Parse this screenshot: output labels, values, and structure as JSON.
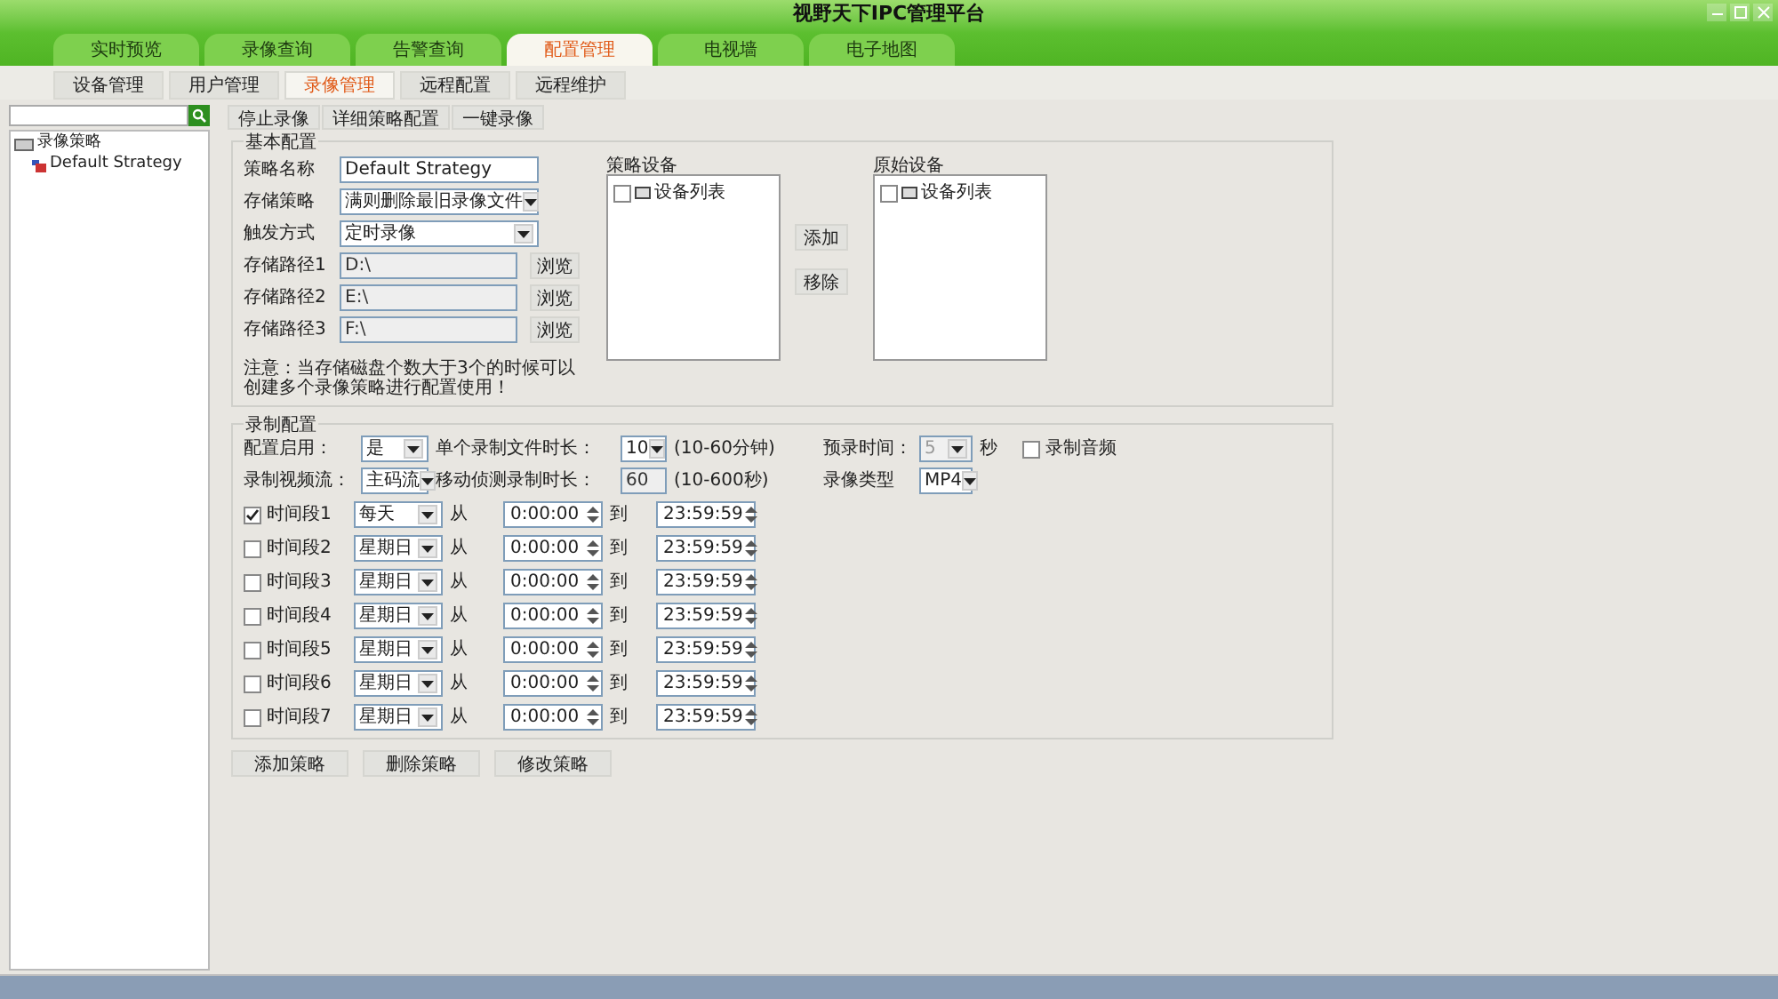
{
  "window": {
    "title": "视野天下IPC管理平台"
  },
  "main_tabs": [
    {
      "label": "实时预览",
      "selected": false
    },
    {
      "label": "录像查询",
      "selected": false
    },
    {
      "label": "告警查询",
      "selected": false
    },
    {
      "label": "配置管理",
      "selected": true
    },
    {
      "label": "电视墙",
      "selected": false
    },
    {
      "label": "电子地图",
      "selected": false
    }
  ],
  "sub_tabs": [
    {
      "label": "设备管理",
      "selected": false
    },
    {
      "label": "用户管理",
      "selected": false
    },
    {
      "label": "录像管理",
      "selected": true
    },
    {
      "label": "远程配置",
      "selected": false
    },
    {
      "label": "远程维护",
      "selected": false
    }
  ],
  "tree": [
    {
      "label": "录像策略",
      "children": [
        {
          "label": "Default Strategy"
        }
      ]
    }
  ],
  "toolbar": [
    "停止录像",
    "详细策略配置",
    "一键录像"
  ],
  "basic_config": {
    "title": "基本配置",
    "fields": [
      {
        "kind": "text",
        "label": "策略名称",
        "value": "Default Strategy"
      },
      {
        "kind": "select",
        "label": "存储策略",
        "value": "满则删除最旧录像文件"
      },
      {
        "kind": "select",
        "label": "触发方式",
        "value": "定时录像"
      },
      {
        "kind": "path",
        "label": "存储路径1",
        "value": "D:\\",
        "button": "浏览"
      },
      {
        "kind": "path",
        "label": "存储路径2",
        "value": "E:\\",
        "button": "浏览"
      },
      {
        "kind": "path",
        "label": "存储路径3",
        "value": "F:\\",
        "button": "浏览"
      }
    ],
    "note": "注意：当存储磁盘个数大于3个的时候可以创建多个录像策略进行配置使用！",
    "policy_devices": {
      "title": "策略设备",
      "item": "设备列表",
      "checked": false
    },
    "add_button": "添加",
    "remove_button": "移除",
    "original_devices": {
      "title": "原始设备",
      "item": "设备列表",
      "checked": false
    }
  },
  "record_config": {
    "title": "录制配置",
    "enable": {
      "label": "配置启用：",
      "value": "是"
    },
    "file_length": {
      "label": "单个录制文件时长：",
      "value": "10",
      "hint": "(10-60分钟)"
    },
    "prerecord": {
      "label": "预录时间：",
      "value": "5",
      "unit": "秒",
      "disabled": true
    },
    "audio": {
      "label": "录制音频",
      "checked": false
    },
    "stream": {
      "label": "录制视频流：",
      "value": "主码流"
    },
    "motion": {
      "label": "移动侦测录制时长：",
      "value": "60",
      "hint": "(10-600秒)",
      "disabled": true
    },
    "type": {
      "label": "录像类型",
      "value": "MP4"
    },
    "periods": [
      {
        "label": "时间段1",
        "checked": true,
        "day": "每天",
        "from": "从",
        "start": "0:00:00",
        "to": "到",
        "end": "23:59:59"
      },
      {
        "label": "时间段2",
        "checked": false,
        "day": "星期日",
        "from": "从",
        "start": "0:00:00",
        "to": "到",
        "end": "23:59:59"
      },
      {
        "label": "时间段3",
        "checked": false,
        "day": "星期日",
        "from": "从",
        "start": "0:00:00",
        "to": "到",
        "end": "23:59:59"
      },
      {
        "label": "时间段4",
        "checked": false,
        "day": "星期日",
        "from": "从",
        "start": "0:00:00",
        "to": "到",
        "end": "23:59:59"
      },
      {
        "label": "时间段5",
        "checked": false,
        "day": "星期日",
        "from": "从",
        "start": "0:00:00",
        "to": "到",
        "end": "23:59:59"
      },
      {
        "label": "时间段6",
        "checked": false,
        "day": "星期日",
        "from": "从",
        "start": "0:00:00",
        "to": "到",
        "end": "23:59:59"
      },
      {
        "label": "时间段7",
        "checked": false,
        "day": "星期日",
        "from": "从",
        "start": "0:00:00",
        "to": "到",
        "end": "23:59:59"
      }
    ]
  },
  "bottom_buttons": [
    "添加策略",
    "删除策略",
    "修改策略"
  ]
}
